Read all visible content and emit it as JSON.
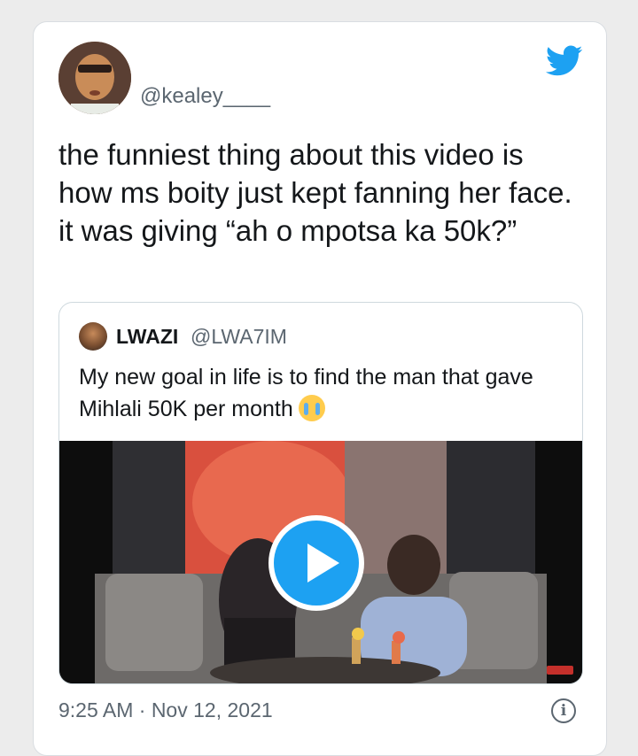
{
  "tweet": {
    "handle": "@kealey____",
    "text": "the funniest thing about this video is how ms boity just kept fanning her face. it was giving “ah o mpotsa ka 50k?”",
    "timestamp": "9:25 AM · Nov 12, 2021",
    "brand_color": "#1da1f2",
    "icons": [
      "twitter-bird-icon",
      "info-icon",
      "play-icon"
    ]
  },
  "quoted": {
    "name": "LWAZI",
    "handle": "@LWA7IM",
    "text": "My new goal in life is to find the man that gave Mihlali 50K per month",
    "emoji": "loudly-crying-face"
  },
  "info_glyph": "i"
}
